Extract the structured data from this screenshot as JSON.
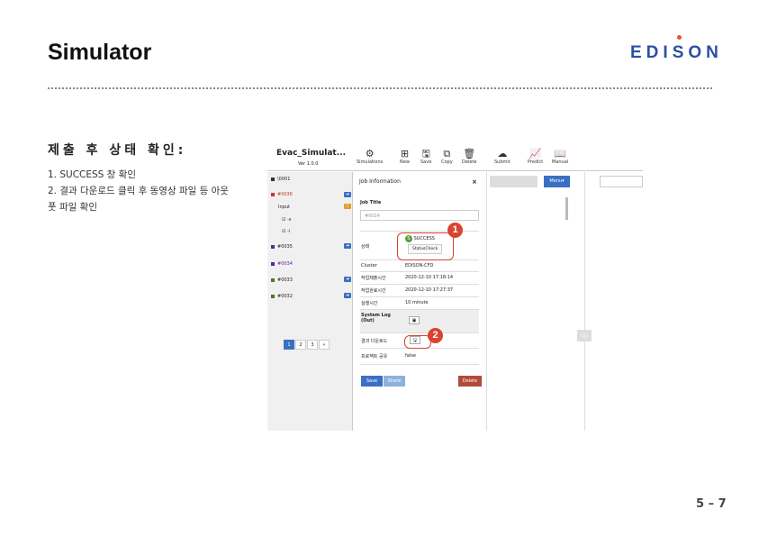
{
  "header": {
    "title": "Simulator",
    "logo": "EDISON",
    "logo_parts": [
      "EDI",
      "S",
      "ON"
    ]
  },
  "section": {
    "subtitle": "제출 후 상태 확인:",
    "steps": [
      "1. SUCCESS 창 확인",
      "2. 결과 다운로드 클릭 후 동영상 파일 등 아웃풋 파일 확인"
    ]
  },
  "page_number": "5 – 7",
  "app": {
    "name": "Evac_Simulat...",
    "version": "Ver 1.0.0",
    "toolbar": [
      {
        "label": "Simulations",
        "icon": "simulations-icon",
        "glyph": "⚙"
      },
      {
        "label": "New",
        "icon": "new-icon",
        "glyph": "⊞"
      },
      {
        "label": "Save",
        "icon": "save-icon",
        "glyph": "🖫"
      },
      {
        "label": "Copy",
        "icon": "copy-icon",
        "glyph": "⧉"
      },
      {
        "label": "Delete",
        "icon": "delete-icon",
        "glyph": "🗑"
      },
      {
        "label": "Submit",
        "icon": "submit-icon",
        "glyph": "☁"
      },
      {
        "label": "Predict",
        "icon": "predict-icon",
        "glyph": "📈"
      },
      {
        "label": "Manual",
        "icon": "manual-icon",
        "glyph": "📖"
      }
    ],
    "sidebar": {
      "items": [
        {
          "label": "\\0001",
          "color": "#222222"
        },
        {
          "label": "#0036",
          "color": "#c0392b"
        },
        {
          "label": "Input",
          "color": "#222222"
        },
        {
          "label": "-s",
          "color": "#222222"
        },
        {
          "label": "-i",
          "color": "#222222"
        },
        {
          "label": "#0035",
          "color": "#2c3e99"
        },
        {
          "label": "#0034",
          "color": "#6a1fa0"
        },
        {
          "label": "#0033",
          "color": "#222222"
        },
        {
          "label": "#0032",
          "color": "#222222"
        }
      ],
      "pages": [
        "1",
        "2",
        "3",
        "»"
      ]
    },
    "panel": {
      "title": "Job Information",
      "close": "×",
      "job_title_label": "Job Title",
      "job_title_value": "#0024",
      "rows": [
        {
          "key": "상태",
          "value": "SUCCESS"
        },
        {
          "key": "Cluster",
          "value": "EDISON-CFD"
        },
        {
          "key": "작업제출시간",
          "value": "2020-12-10 17:18:14"
        },
        {
          "key": "작업완료시간",
          "value": "2020-12-10 17:27:37"
        },
        {
          "key": "실행시간",
          "value": "10 minute"
        },
        {
          "key": "System Log (Out)",
          "value": ""
        },
        {
          "key": "결과 다운로드",
          "value": ""
        },
        {
          "key": "프로젝트 공유",
          "value": "false"
        }
      ],
      "status_badge": "S",
      "status_check": "StatusCheck",
      "save": "Save",
      "share": "Share",
      "delete": "Delete"
    },
    "menu": "Menu▾",
    "callouts": [
      "1",
      "2"
    ],
    "colors": {
      "accent": "#3b6fc4",
      "danger": "#d9432f",
      "success": "#5a9e3a"
    }
  }
}
